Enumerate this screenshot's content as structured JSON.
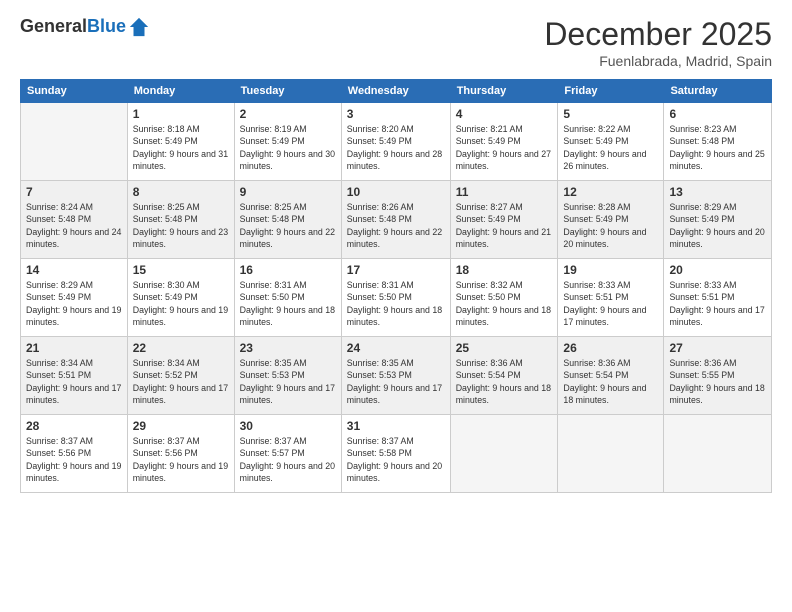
{
  "header": {
    "logo_general": "General",
    "logo_blue": "Blue",
    "month_title": "December 2025",
    "location": "Fuenlabrada, Madrid, Spain"
  },
  "days_of_week": [
    "Sunday",
    "Monday",
    "Tuesday",
    "Wednesday",
    "Thursday",
    "Friday",
    "Saturday"
  ],
  "weeks": [
    [
      {
        "day": "",
        "sunrise": "",
        "sunset": "",
        "daylight": "",
        "empty": true
      },
      {
        "day": "1",
        "sunrise": "Sunrise: 8:18 AM",
        "sunset": "Sunset: 5:49 PM",
        "daylight": "Daylight: 9 hours and 31 minutes."
      },
      {
        "day": "2",
        "sunrise": "Sunrise: 8:19 AM",
        "sunset": "Sunset: 5:49 PM",
        "daylight": "Daylight: 9 hours and 30 minutes."
      },
      {
        "day": "3",
        "sunrise": "Sunrise: 8:20 AM",
        "sunset": "Sunset: 5:49 PM",
        "daylight": "Daylight: 9 hours and 28 minutes."
      },
      {
        "day": "4",
        "sunrise": "Sunrise: 8:21 AM",
        "sunset": "Sunset: 5:49 PM",
        "daylight": "Daylight: 9 hours and 27 minutes."
      },
      {
        "day": "5",
        "sunrise": "Sunrise: 8:22 AM",
        "sunset": "Sunset: 5:49 PM",
        "daylight": "Daylight: 9 hours and 26 minutes."
      },
      {
        "day": "6",
        "sunrise": "Sunrise: 8:23 AM",
        "sunset": "Sunset: 5:48 PM",
        "daylight": "Daylight: 9 hours and 25 minutes."
      }
    ],
    [
      {
        "day": "7",
        "sunrise": "Sunrise: 8:24 AM",
        "sunset": "Sunset: 5:48 PM",
        "daylight": "Daylight: 9 hours and 24 minutes."
      },
      {
        "day": "8",
        "sunrise": "Sunrise: 8:25 AM",
        "sunset": "Sunset: 5:48 PM",
        "daylight": "Daylight: 9 hours and 23 minutes."
      },
      {
        "day": "9",
        "sunrise": "Sunrise: 8:25 AM",
        "sunset": "Sunset: 5:48 PM",
        "daylight": "Daylight: 9 hours and 22 minutes."
      },
      {
        "day": "10",
        "sunrise": "Sunrise: 8:26 AM",
        "sunset": "Sunset: 5:48 PM",
        "daylight": "Daylight: 9 hours and 22 minutes."
      },
      {
        "day": "11",
        "sunrise": "Sunrise: 8:27 AM",
        "sunset": "Sunset: 5:49 PM",
        "daylight": "Daylight: 9 hours and 21 minutes."
      },
      {
        "day": "12",
        "sunrise": "Sunrise: 8:28 AM",
        "sunset": "Sunset: 5:49 PM",
        "daylight": "Daylight: 9 hours and 20 minutes."
      },
      {
        "day": "13",
        "sunrise": "Sunrise: 8:29 AM",
        "sunset": "Sunset: 5:49 PM",
        "daylight": "Daylight: 9 hours and 20 minutes."
      }
    ],
    [
      {
        "day": "14",
        "sunrise": "Sunrise: 8:29 AM",
        "sunset": "Sunset: 5:49 PM",
        "daylight": "Daylight: 9 hours and 19 minutes."
      },
      {
        "day": "15",
        "sunrise": "Sunrise: 8:30 AM",
        "sunset": "Sunset: 5:49 PM",
        "daylight": "Daylight: 9 hours and 19 minutes."
      },
      {
        "day": "16",
        "sunrise": "Sunrise: 8:31 AM",
        "sunset": "Sunset: 5:50 PM",
        "daylight": "Daylight: 9 hours and 18 minutes."
      },
      {
        "day": "17",
        "sunrise": "Sunrise: 8:31 AM",
        "sunset": "Sunset: 5:50 PM",
        "daylight": "Daylight: 9 hours and 18 minutes."
      },
      {
        "day": "18",
        "sunrise": "Sunrise: 8:32 AM",
        "sunset": "Sunset: 5:50 PM",
        "daylight": "Daylight: 9 hours and 18 minutes."
      },
      {
        "day": "19",
        "sunrise": "Sunrise: 8:33 AM",
        "sunset": "Sunset: 5:51 PM",
        "daylight": "Daylight: 9 hours and 17 minutes."
      },
      {
        "day": "20",
        "sunrise": "Sunrise: 8:33 AM",
        "sunset": "Sunset: 5:51 PM",
        "daylight": "Daylight: 9 hours and 17 minutes."
      }
    ],
    [
      {
        "day": "21",
        "sunrise": "Sunrise: 8:34 AM",
        "sunset": "Sunset: 5:51 PM",
        "daylight": "Daylight: 9 hours and 17 minutes."
      },
      {
        "day": "22",
        "sunrise": "Sunrise: 8:34 AM",
        "sunset": "Sunset: 5:52 PM",
        "daylight": "Daylight: 9 hours and 17 minutes."
      },
      {
        "day": "23",
        "sunrise": "Sunrise: 8:35 AM",
        "sunset": "Sunset: 5:53 PM",
        "daylight": "Daylight: 9 hours and 17 minutes."
      },
      {
        "day": "24",
        "sunrise": "Sunrise: 8:35 AM",
        "sunset": "Sunset: 5:53 PM",
        "daylight": "Daylight: 9 hours and 17 minutes."
      },
      {
        "day": "25",
        "sunrise": "Sunrise: 8:36 AM",
        "sunset": "Sunset: 5:54 PM",
        "daylight": "Daylight: 9 hours and 18 minutes."
      },
      {
        "day": "26",
        "sunrise": "Sunrise: 8:36 AM",
        "sunset": "Sunset: 5:54 PM",
        "daylight": "Daylight: 9 hours and 18 minutes."
      },
      {
        "day": "27",
        "sunrise": "Sunrise: 8:36 AM",
        "sunset": "Sunset: 5:55 PM",
        "daylight": "Daylight: 9 hours and 18 minutes."
      }
    ],
    [
      {
        "day": "28",
        "sunrise": "Sunrise: 8:37 AM",
        "sunset": "Sunset: 5:56 PM",
        "daylight": "Daylight: 9 hours and 19 minutes."
      },
      {
        "day": "29",
        "sunrise": "Sunrise: 8:37 AM",
        "sunset": "Sunset: 5:56 PM",
        "daylight": "Daylight: 9 hours and 19 minutes."
      },
      {
        "day": "30",
        "sunrise": "Sunrise: 8:37 AM",
        "sunset": "Sunset: 5:57 PM",
        "daylight": "Daylight: 9 hours and 20 minutes."
      },
      {
        "day": "31",
        "sunrise": "Sunrise: 8:37 AM",
        "sunset": "Sunset: 5:58 PM",
        "daylight": "Daylight: 9 hours and 20 minutes."
      },
      {
        "day": "",
        "sunrise": "",
        "sunset": "",
        "daylight": "",
        "empty": true
      },
      {
        "day": "",
        "sunrise": "",
        "sunset": "",
        "daylight": "",
        "empty": true
      },
      {
        "day": "",
        "sunrise": "",
        "sunset": "",
        "daylight": "",
        "empty": true
      }
    ]
  ]
}
